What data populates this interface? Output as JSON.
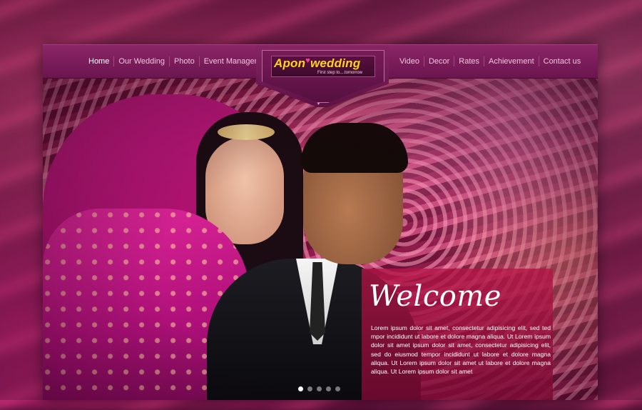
{
  "nav": {
    "left": [
      {
        "label": "Home",
        "active": true
      },
      {
        "label": "Our Wedding",
        "active": false
      },
      {
        "label": "Photo",
        "active": false
      },
      {
        "label": "Event Management",
        "active": false
      }
    ],
    "right": [
      {
        "label": "Video"
      },
      {
        "label": "Decor"
      },
      {
        "label": "Rates"
      },
      {
        "label": "Achievement"
      },
      {
        "label": "Contact us"
      }
    ]
  },
  "logo": {
    "word1": "Apon",
    "word2": "wedding",
    "tagline": "First step to....tomorrow"
  },
  "hero": {
    "welcome_title": "Welcome",
    "welcome_body": "Lorem ipsum dolor sit amet, consectetur adipisicing elit, sed ted mpor incididunt ut labore et dolore magna aliqua. Ut Lorem ipsum dolor sit amet ipsum dolor sit amet, consectetur adipisicing elit, sed do eiusmod tempor incididunt ut labore et dolore magna aliqua. Ut Lorem ipsum dolor sit amet ut labore et dolore magna aliqua. Ut Lorem ipsum dolor sit amet"
  },
  "slider": {
    "count": 5,
    "active_index": 0
  },
  "colors": {
    "nav_bg": "#7a1b59",
    "nav_text": "#f3c3e0",
    "logo_text": "#ffd21c",
    "welcome_panel": "#b01448"
  }
}
